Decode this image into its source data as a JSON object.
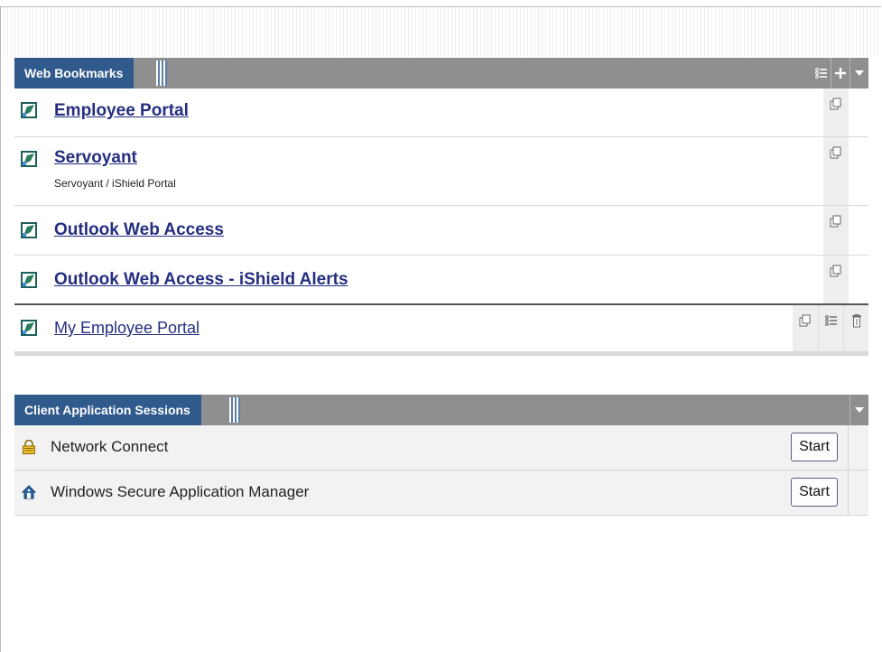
{
  "web_bookmarks": {
    "title": "Web Bookmarks",
    "header_tools": [
      "list-icon",
      "plus-icon",
      "triangle-down-icon"
    ],
    "items": [
      {
        "label": "Employee Portal",
        "description": ""
      },
      {
        "label": "Servoyant",
        "description": "Servoyant / iShield Portal"
      },
      {
        "label": "Outlook Web Access",
        "description": ""
      },
      {
        "label": "Outlook Web Access - iShield Alerts",
        "description": ""
      },
      {
        "label": "My Employee Portal",
        "description": ""
      }
    ]
  },
  "client_apps": {
    "title": "Client Application Sessions",
    "items": [
      {
        "label": "Network Connect",
        "icon": "lock-icon",
        "button": "Start"
      },
      {
        "label": "Windows Secure Application Manager",
        "icon": "house-icon",
        "button": "Start"
      }
    ]
  },
  "colors": {
    "header_bar": "#8f8f8f",
    "title_tab": "#30598c",
    "link": "#252e80"
  }
}
